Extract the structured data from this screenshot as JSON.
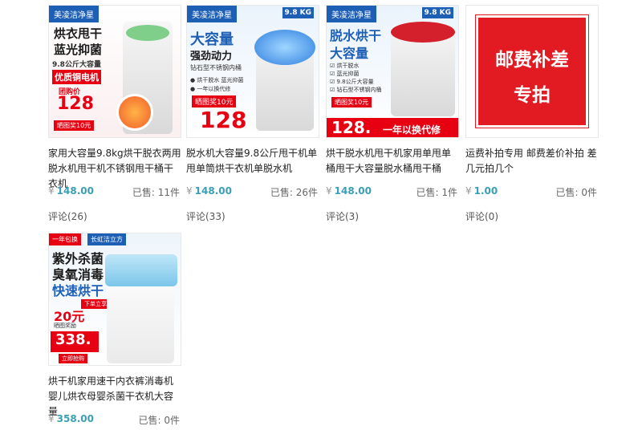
{
  "products": [
    {
      "title": "家用大容量9.8kg烘干脱衣两用脱水机甩干机不锈钢甩干桶干衣机",
      "currency": "¥",
      "price": "148.00",
      "sold_label": "已售:",
      "sold_count": "11件",
      "reviews": "评论(26)",
      "thumb": {
        "brand": "美凌洁净星",
        "line1": "烘衣甩干",
        "line2": "蓝光抑菌",
        "line3": "9.8公斤大容量",
        "line4": "优质铜电机",
        "promo": "团购价",
        "price": "128",
        "bonus": "晒图奖10元"
      }
    },
    {
      "title": "脱水机大容量9.8公斤甩干机单甩单筒烘干衣机单脱水机",
      "currency": "¥",
      "price": "148.00",
      "sold_label": "已售:",
      "sold_count": "26件",
      "reviews": "评论(33)",
      "thumb": {
        "brand": "美凌洁净星",
        "kg": "9.8 KG",
        "line1": "大容量",
        "line2": "强劲动力",
        "line3": "钻石型不锈钢内桶",
        "f1": "● 烘干脱水 蓝光抑菌",
        "f2": "● 一年以换代修",
        "bonus": "晒图奖10元",
        "price": "128"
      }
    },
    {
      "title": "烘干脱水机甩干机家用单甩单桶甩干大容量脱水桶甩干桶",
      "currency": "¥",
      "price": "148.00",
      "sold_label": "已售:",
      "sold_count": "1件",
      "reviews": "评论(3)",
      "thumb": {
        "brand": "美凌洁净星",
        "kg": "9.8 KG",
        "line1": "脱水烘干",
        "line2": "大容量",
        "f1": "☑ 烘干脱水",
        "f2": "☑ 蓝光抑菌",
        "f3": "☑ 9.8公斤大容量",
        "f4": "☑ 钻石型不锈钢内桶",
        "bonus": "晒图奖10元",
        "price": "128.",
        "guarantee": "一年以换代修"
      }
    },
    {
      "title": "运费补拍专用 邮费差价补拍 差几元拍几个",
      "currency": "¥",
      "price": "1.00",
      "sold_label": "已售:",
      "sold_count": "0件",
      "reviews": "评论(0)",
      "thumb": {
        "line1": "邮费补差",
        "line2": "专拍"
      }
    },
    {
      "title": "烘干机家用速干内衣裤消毒机婴儿烘衣母婴杀菌干衣机大容量",
      "currency": "¥",
      "price": "358.00",
      "sold_label": "已售:",
      "sold_count": "0件",
      "reviews": null,
      "thumb": {
        "tag1": "一年包换",
        "tag2": "长虹洁立方",
        "line1": "紫外杀菌",
        "line2": "臭氧消毒",
        "line3": "快速烘干",
        "order": "下单立享",
        "coupon": "20元",
        "coupon_note": "晒图奖励",
        "price": "338.",
        "buy": "立即抢购"
      }
    }
  ],
  "colors": {
    "price": "#3a9fb5",
    "accent_red": "#e60012",
    "brand_blue": "#1e5fb6"
  }
}
